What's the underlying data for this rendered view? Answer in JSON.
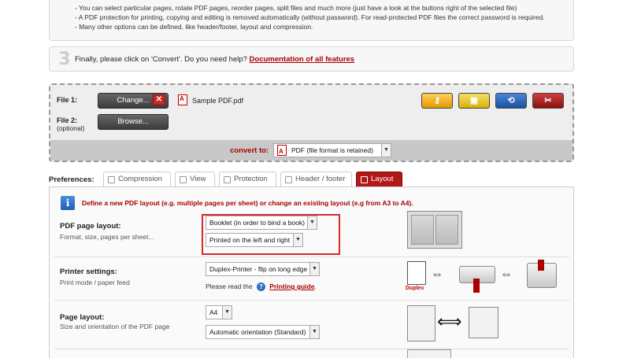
{
  "step2": {
    "bullets": [
      "- You can select particular pages, rotate PDF pages, reorder pages, split files and much more (just have a look at the buttons right of the selected file)",
      "- A PDF protection for printing, copying and editing is removed automatically (without password). For read-protected PDF files the correct password is required.",
      "- Many other options can be defined, like header/footer, layout and compression."
    ]
  },
  "step3": {
    "number": "3",
    "text": "Finally, please click on 'Convert'. Do you need help?",
    "link": "Documentation of all features"
  },
  "files": {
    "file1_label": "File 1:",
    "change_button": "Change...",
    "remove_icon": "close-icon",
    "file1_name": "Sample PDF.pdf",
    "file2_label": "File 2:",
    "file2_sub": "(optional)",
    "browse_button": "Browse...",
    "tools": [
      "key-icon",
      "lock-icon",
      "rotate-icon",
      "scissors-icon"
    ]
  },
  "convert": {
    "label": "convert to:",
    "selected": "PDF (file format is retained)"
  },
  "preferences": {
    "label": "Preferences:",
    "tabs": [
      "Compression",
      "View",
      "Protection",
      "Header / footer",
      "Layout"
    ],
    "active_tab": "Layout"
  },
  "layout": {
    "info": "Define a new PDF layout (e.g. multiple pages per sheet) or change an existing layout (e.g from A3 to A4).",
    "page_layout_title": "PDF page layout:",
    "page_layout_sub": "Format, size, pages per sheet...",
    "page_layout_value": "Booklet (in order to bind a book)",
    "page_layout_value2": "Printed on the left and right",
    "printer_title": "Printer settings:",
    "printer_sub": "Print mode / paper feed",
    "printer_value": "Duplex-Printer - flip on long edge",
    "printer_note": "Please read the",
    "printer_link": "Printing guide",
    "printer_link_suffix": ".",
    "duplex_label": "Duplex",
    "pagesize_title": "Page layout:",
    "pagesize_sub": "Size and orientation of the PDF page",
    "pagesize_value": "A4",
    "orientation_value": "Automatic orientation (Standard)"
  },
  "colors": {
    "accent": "#a80000",
    "highlight": "#d42a2a",
    "active_tab": "#b01818"
  }
}
